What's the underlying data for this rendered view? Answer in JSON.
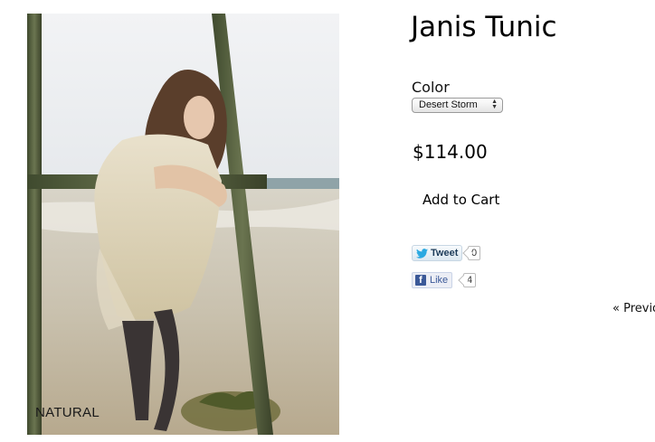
{
  "product": {
    "title": "Janis Tunic",
    "image_caption": "NATURAL",
    "color_label": "Color",
    "color_selected": "Desert Storm",
    "price": "$114.00",
    "add_to_cart_label": "Add to Cart"
  },
  "social": {
    "tweet_label": "Tweet",
    "tweet_count": "0",
    "like_label": "Like",
    "like_count": "4"
  },
  "pagination": {
    "previous_label": "« Previous"
  }
}
